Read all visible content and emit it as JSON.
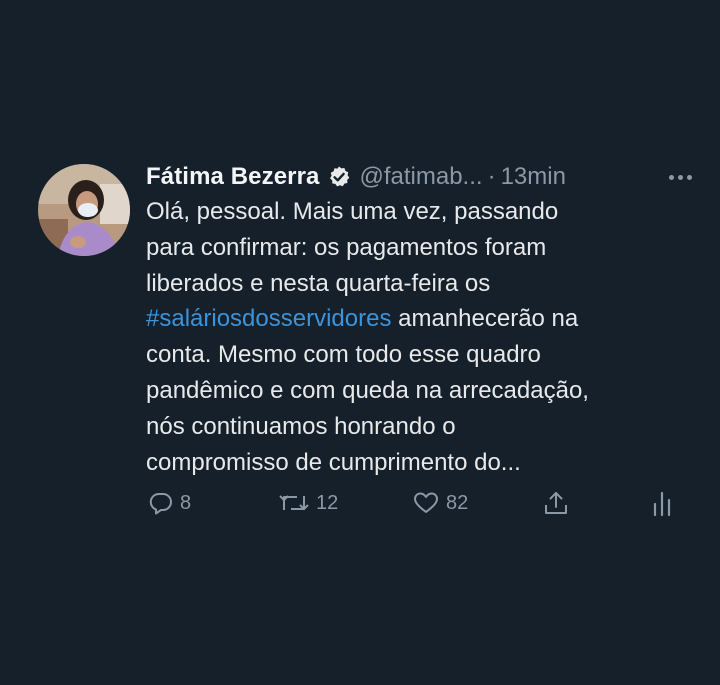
{
  "tweet": {
    "author_name": "Fátima Bezerra",
    "handle": "@fatimab...",
    "separator": "·",
    "time": "13min",
    "text_lines": [
      "Olá, pessoal. Mais uma vez, passando",
      "para confirmar: os pagamentos foram",
      "liberados e nesta quarta-feira os"
    ],
    "hashtag": "#saláriosdosservidores",
    "hashtag_after": " amanhecerão na",
    "text_lines_end": [
      "conta. Mesmo com todo esse quadro",
      "pandêmico e com queda na arrecadação,",
      "nós continuamos honrando o",
      "compromisso de cumprimento do..."
    ],
    "replies": "8",
    "retweets": "12",
    "likes": "82"
  },
  "icons": {
    "verified": "verified-badge-icon",
    "more": "more-options-icon",
    "reply": "reply-icon",
    "retweet": "retweet-icon",
    "like": "heart-icon",
    "share": "share-icon",
    "analytics": "analytics-icon"
  },
  "colors": {
    "background": "#15202b",
    "text": "#e8e9ea",
    "secondary": "#8b98a5",
    "hashtag": "#3b94d9"
  }
}
